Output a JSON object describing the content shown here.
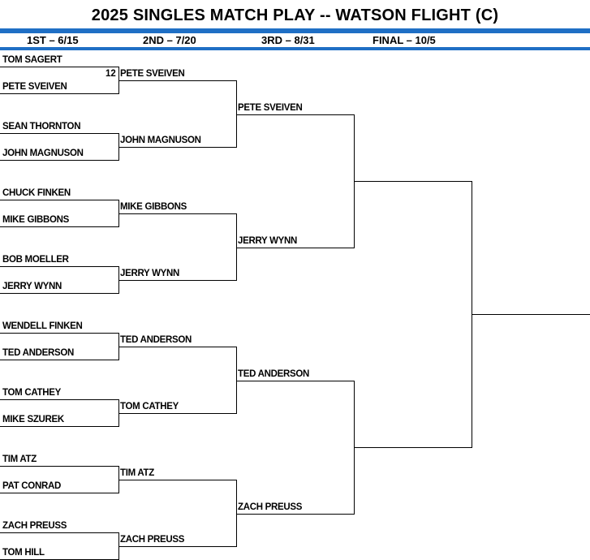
{
  "title": "2025 SINGLES MATCH PLAY -- WATSON FLIGHT (C)",
  "rounds": [
    "1ST – 6/15",
    "2ND – 7/20",
    "3RD – 8/31",
    "FINAL – 10/5"
  ],
  "round1": [
    "TOM SAGERT",
    "PETE SVEIVEN",
    "SEAN THORNTON",
    "JOHN MAGNUSON",
    "CHUCK FINKEN",
    "MIKE GIBBONS",
    "BOB MOELLER",
    "JERRY WYNN",
    "WENDELL FINKEN",
    "TED ANDERSON",
    "TOM CATHEY",
    "MIKE SZUREK",
    "TIM ATZ",
    "PAT CONRAD",
    "ZACH PREUSS",
    "TOM HILL"
  ],
  "round1_seed": "12",
  "round2": [
    "PETE SVEIVEN",
    "JOHN MAGNUSON",
    "MIKE GIBBONS",
    "JERRY WYNN",
    "TED ANDERSON",
    "TOM CATHEY",
    "TIM ATZ",
    "ZACH PREUSS"
  ],
  "round3": [
    "PETE SVEIVEN",
    "JERRY WYNN",
    "TED ANDERSON",
    "ZACH PREUSS"
  ],
  "round4": [
    "",
    ""
  ],
  "champion": ""
}
